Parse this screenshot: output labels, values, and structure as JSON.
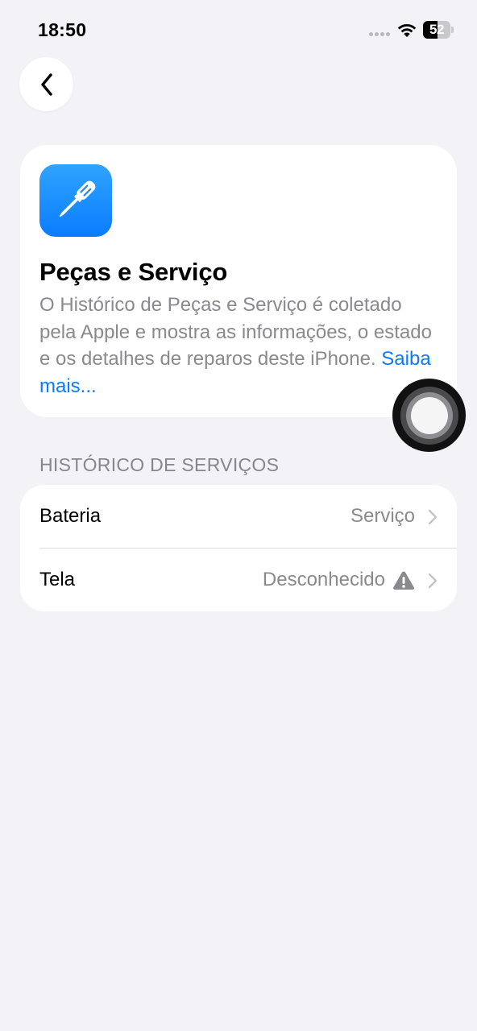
{
  "status_bar": {
    "time": "18:50",
    "battery_level": "52",
    "battery_fraction": 0.52
  },
  "header": {
    "back_icon": "chevron-left-icon"
  },
  "info_card": {
    "icon": "screwdriver-icon",
    "icon_color": "#1a8cff",
    "title": "Peças e Serviço",
    "description": "O Histórico de Peças e Serviço é coletado pela Apple e mostra as informações, o estado e os detalhes de reparos deste iPhone.",
    "link_text": "Saiba mais...",
    "link_color": "#0a7aff"
  },
  "service_history": {
    "header": "HISTÓRICO DE SERVIÇOS",
    "rows": [
      {
        "label": "Bateria",
        "value": "Serviço",
        "warning": false
      },
      {
        "label": "Tela",
        "value": "Desconhecido",
        "warning": true
      }
    ]
  }
}
